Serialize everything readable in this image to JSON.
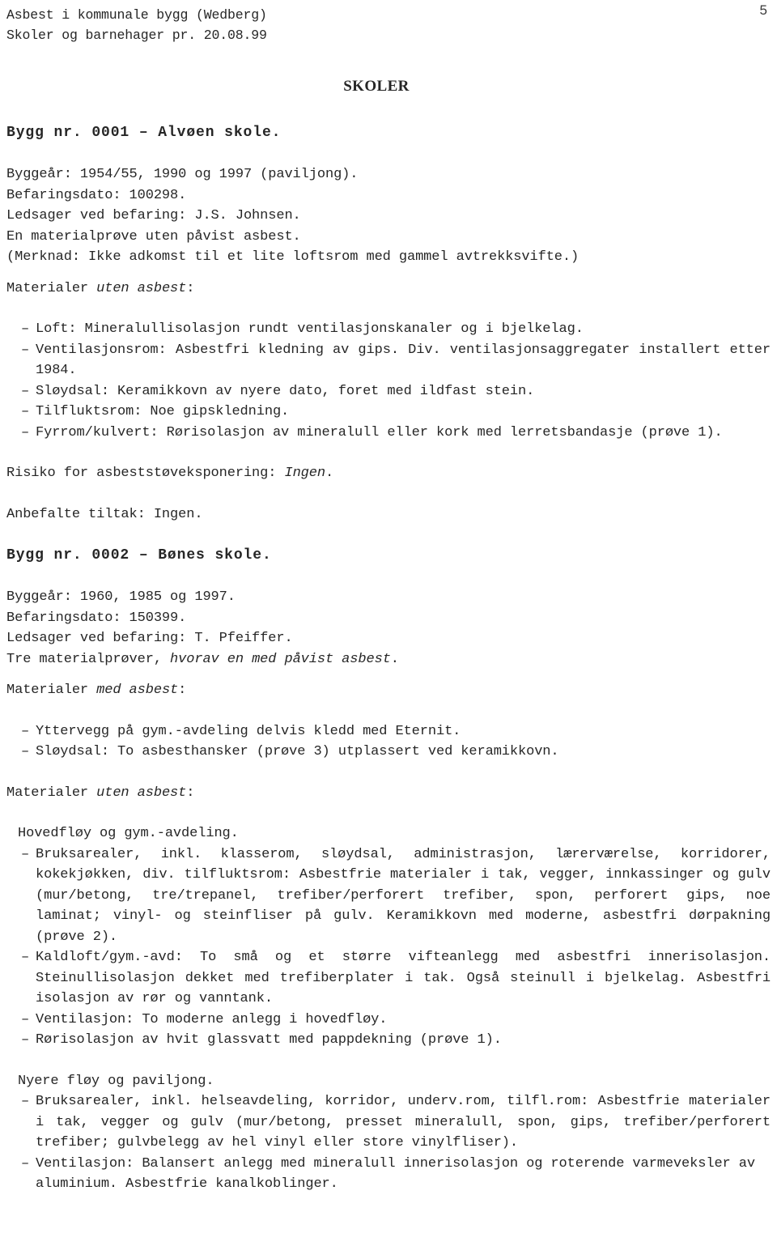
{
  "document": {
    "header_line_1": "Asbest i kommunale bygg (Wedberg)",
    "header_line_2": "Skoler og barnehager pr. 20.08.99",
    "page_number": "5",
    "title": "SKOLER"
  },
  "buildings": [
    {
      "heading": "Bygg nr. 0001 – Alvøen skole.",
      "meta": [
        "Byggeår: 1954/55, 1990 og 1997 (paviljong).",
        "Befaringsdato: 100298.",
        "Ledsager ved befaring: J.S. Johnsen.",
        "En materialprøve uten påvist asbest.",
        "(Merknad: Ikke adkomst til et lite loftsrom med gammel avtrekksvifte.)"
      ],
      "sections": [
        {
          "head_prefix": "Materialer ",
          "head_em": "uten asbest",
          "head_suffix": ":",
          "bullets": [
            "Loft: Mineralullisolasjon rundt ventilasjonskanaler og i bjelkelag.",
            "Ventilasjonsrom: Asbestfri kledning av gips. Div. ventilasjonsaggregater installert etter 1984.",
            "Sløydsal: Keramikkovn av nyere dato, foret med ildfast stein.",
            "Tilfluktsrom: Noe gipskledning.",
            "Fyrrom/kulvert: Rørisolasjon av mineralull eller kork med lerretsbandasje (prøve 1)."
          ]
        }
      ],
      "risk_prefix": "Risiko for asbeststøveksponering: ",
      "risk_em": "Ingen",
      "risk_suffix": ".",
      "measures": "Anbefalte tiltak: Ingen."
    },
    {
      "heading": "Bygg nr. 0002 – Bønes skole.",
      "meta_plain": [
        "Byggeår: 1960, 1985 og 1997.",
        "Befaringsdato: 150399.",
        "Ledsager ved befaring: T. Pfeiffer."
      ],
      "meta_italic_line": {
        "prefix": "Tre materialprøver, ",
        "em": "hvorav en med påvist asbest",
        "suffix": "."
      },
      "section_med": {
        "head_prefix": "Materialer ",
        "head_em": "med asbest",
        "head_suffix": ":",
        "bullets": [
          "Yttervegg på gym.-avdeling delvis kledd med Eternit.",
          "Sløydsal: To asbesthansker (prøve 3) utplassert ved keramikkovn."
        ]
      },
      "section_uten": {
        "head_prefix": "Materialer ",
        "head_em": "uten asbest",
        "head_suffix": ":",
        "groups": [
          {
            "subhead": "Hovedfløy og gym.-avdeling.",
            "bullets": [
              "Bruksarealer, inkl. klasserom, sløydsal, administrasjon, lærerværelse, korridorer, kokekjøkken, div. tilfluktsrom: Asbestfrie materialer i tak, vegger, innkassinger og gulv (mur/betong, tre/trepanel, trefiber/perforert trefiber, spon, perforert gips, noe laminat; vinyl- og steinfliser på gulv. Keramikkovn med moderne, asbestfri dørpakning (prøve 2).",
              "Kaldloft/gym.-avd: To små og et større vifteanlegg med asbestfri innerisolasjon. Steinullisolasjon dekket med trefiberplater i tak. Også steinull i bjelkelag. Asbestfri isolasjon av rør og vanntank.",
              "Ventilasjon: To moderne anlegg i hovedfløy.",
              "Rørisolasjon av hvit glassvatt med pappdekning (prøve 1)."
            ]
          },
          {
            "subhead": "Nyere fløy og paviljong.",
            "bullets": [
              "Bruksarealer, inkl. helseavdeling, korridor, underv.rom, tilfl.rom: Asbestfrie materialer i tak, vegger og gulv (mur/betong, presset mineralull, spon, gips, trefiber/perforert trefiber; gulvbelegg av hel vinyl eller store vinylfliser).",
              "Ventilasjon: Balansert anlegg med mineralull innerisolasjon og roterende varmeveksler av aluminium. Asbestfrie kanalkoblinger."
            ]
          }
        ]
      }
    }
  ]
}
